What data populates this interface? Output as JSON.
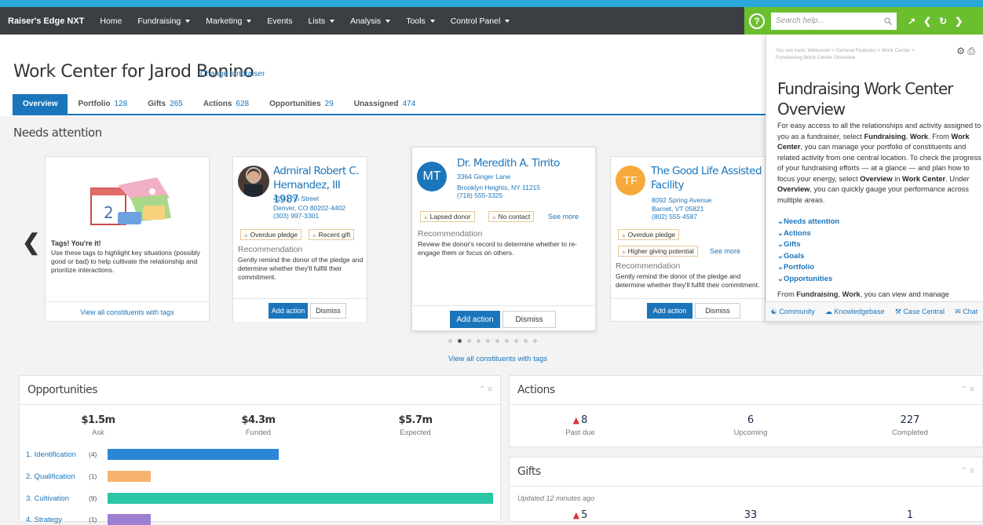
{
  "nav": {
    "brand": "Raiser's Edge NXT",
    "items": [
      "Home",
      "Fundraising",
      "Marketing",
      "Events",
      "Lists",
      "Analysis",
      "Tools",
      "Control Panel"
    ],
    "dropdown": [
      false,
      true,
      true,
      false,
      true,
      true,
      true,
      true
    ]
  },
  "help_search": {
    "placeholder": "Search help..."
  },
  "header": {
    "title": "Work Center for Jarod Bonino",
    "change_link": "Change fundraiser",
    "tabs": [
      {
        "label": "Overview",
        "count": ""
      },
      {
        "label": "Portfolio",
        "count": "128"
      },
      {
        "label": "Gifts",
        "count": "265"
      },
      {
        "label": "Actions",
        "count": "628"
      },
      {
        "label": "Opportunities",
        "count": "29"
      },
      {
        "label": "Unassigned",
        "count": "474"
      }
    ]
  },
  "needs_attention": {
    "heading": "Needs attention",
    "intro_card": {
      "title": "Tags! You're it!",
      "text": "Use these tags to highlight key situations (possibly good or bad) to help cultivate the relationship and prioritize interactions.",
      "link": "View all constituents with tags"
    },
    "cards": [
      {
        "name": "Admiral Robert C. Hernandez, III 1987",
        "address": [
          "410 17th Street",
          "Denver, CO 80202-4402",
          "(303) 997-3301"
        ],
        "tags": [
          "Overdue pledge",
          "Recent gift"
        ],
        "see_more": "",
        "rec_label": "Recommendation",
        "rec_text": "Gently remind the donor of the pledge and determine whether they'll fulfill their commitment.",
        "add": "Add action",
        "dismiss": "Dismiss"
      },
      {
        "initials": "MT",
        "name": "Dr. Meredith A. Tirrito",
        "address": [
          "3364 Ginger Lane",
          "Brooklyn Heights, NY 11215",
          "(718) 555-3325"
        ],
        "tags": [
          "Lapsed donor",
          "No contact"
        ],
        "see_more": "See more",
        "rec_label": "Recommendation",
        "rec_text": "Review the donor's record to determine whether to re-engage them or focus on others.",
        "add": "Add action",
        "dismiss": "Dismiss"
      },
      {
        "initials": "TF",
        "name": "The Good Life Assisted Care Facility",
        "address": [
          "8092 Spring Avenue",
          "Barnet, VT 05821",
          "(802) 555-4587"
        ],
        "tags": [
          "Overdue pledge",
          "Higher giving potential"
        ],
        "see_more": "See more",
        "rec_label": "Recommendation",
        "rec_text": "Gently remind the donor of the pledge and determine whether they'll fulfill their commitment.",
        "add": "Add action",
        "dismiss": "Dismiss"
      }
    ],
    "view_all": "View all constituents with tags"
  },
  "opportunities": {
    "title": "Opportunities",
    "stats": [
      {
        "value": "$1.5m",
        "label": "Ask"
      },
      {
        "value": "$4.3m",
        "label": "Funded"
      },
      {
        "value": "$5.7m",
        "label": "Expected"
      }
    ],
    "stages": [
      {
        "label": "1. Identification",
        "count": "(4)",
        "value": 4,
        "color": "#2b87d6"
      },
      {
        "label": "2. Qualification",
        "count": "(1)",
        "value": 1,
        "color": "#f7b26d"
      },
      {
        "label": "3. Cultivation",
        "count": "(9)",
        "value": 9,
        "color": "#2cc5a6"
      },
      {
        "label": "4. Strategy",
        "count": "(1)",
        "value": 1,
        "color": "#9d7fd1"
      }
    ]
  },
  "actions": {
    "title": "Actions",
    "stats": [
      {
        "value": "8",
        "label": "Past due",
        "warn": true
      },
      {
        "value": "6",
        "label": "Upcoming"
      },
      {
        "value": "227",
        "label": "Completed"
      }
    ]
  },
  "gifts": {
    "title": "Gifts",
    "updated": "Updated 12 minutes ago",
    "stats": [
      "5",
      "33",
      "1"
    ]
  },
  "help": {
    "breadcrumb": "You are here: Welcome! > General Features > Work Center > Fundraising Work Center Overview",
    "title": "Fundraising Work Center Overview",
    "links": [
      "Needs attention",
      "Actions",
      "Gifts",
      "Goals",
      "Portfolio",
      "Opportunities"
    ],
    "footer": [
      "Community",
      "Knowledgebase",
      "Case Central",
      "Chat"
    ]
  }
}
